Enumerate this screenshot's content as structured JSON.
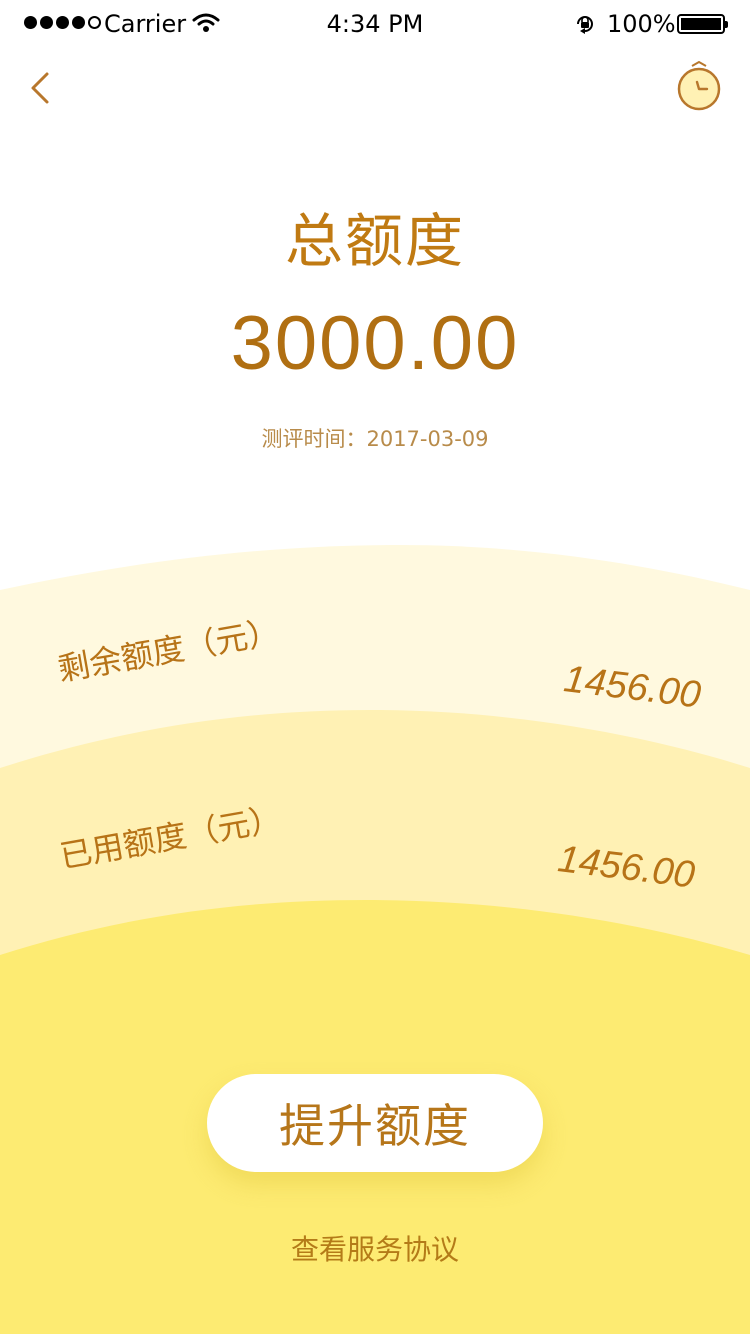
{
  "status_bar": {
    "carrier": "Carrier",
    "time": "4:34 PM",
    "battery": "100%"
  },
  "nav": {
    "back_icon": "chevron-left-icon",
    "history_icon": "clock-icon"
  },
  "credit": {
    "title": "总额度",
    "total": "3000.00",
    "assessment_label": "测评时间：",
    "assessment_date": "2017-03-09"
  },
  "rows": {
    "remaining": {
      "label": "剩余额度（元）",
      "value": "1456.00"
    },
    "used": {
      "label": "已用额度（元）",
      "value": "1456.00"
    }
  },
  "actions": {
    "raise_limit": "提升额度",
    "service_agreement": "查看服务协议"
  },
  "colors": {
    "accent_text": "#B6761A",
    "band_light": "#FFF9DF",
    "band_mid": "#FFF1B4",
    "band_base": "#FDEB72",
    "button_bg": "#FFFFFF"
  }
}
